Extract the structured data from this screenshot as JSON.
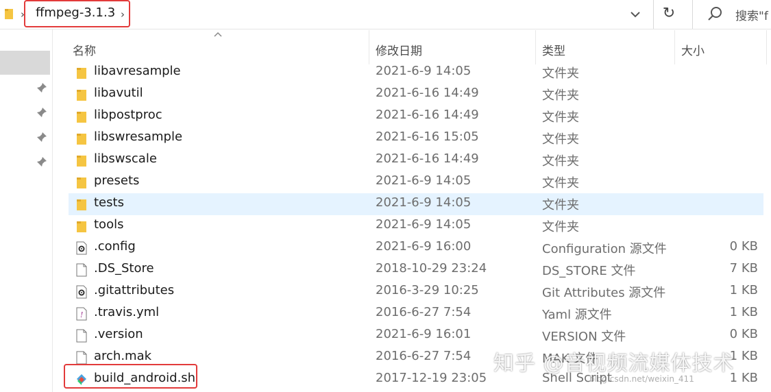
{
  "address_bar": {
    "path": "ffmpeg-3.1.3",
    "search_placeholder": "搜索\"f"
  },
  "columns": {
    "name": "名称",
    "date": "修改日期",
    "type": "类型",
    "size": "大小"
  },
  "files": [
    {
      "name": "libavresample",
      "date": "2021-6-9 14:05",
      "type": "文件夹",
      "size": "",
      "icon": "folder-icon"
    },
    {
      "name": "libavutil",
      "date": "2021-6-16 14:49",
      "type": "文件夹",
      "size": "",
      "icon": "folder-icon"
    },
    {
      "name": "libpostproc",
      "date": "2021-6-16 14:49",
      "type": "文件夹",
      "size": "",
      "icon": "folder-icon"
    },
    {
      "name": "libswresample",
      "date": "2021-6-16 15:05",
      "type": "文件夹",
      "size": "",
      "icon": "folder-icon"
    },
    {
      "name": "libswscale",
      "date": "2021-6-16 14:49",
      "type": "文件夹",
      "size": "",
      "icon": "folder-icon"
    },
    {
      "name": "presets",
      "date": "2021-6-9 14:05",
      "type": "文件夹",
      "size": "",
      "icon": "folder-icon"
    },
    {
      "name": "tests",
      "date": "2021-6-9 14:05",
      "type": "文件夹",
      "size": "",
      "icon": "folder-icon",
      "selected": true
    },
    {
      "name": "tools",
      "date": "2021-6-9 14:05",
      "type": "文件夹",
      "size": "",
      "icon": "folder-icon"
    },
    {
      "name": ".config",
      "date": "2021-6-9 16:00",
      "type": "Configuration 源文件",
      "size": "0 KB",
      "icon": "gear-file-icon"
    },
    {
      "name": ".DS_Store",
      "date": "2018-10-29 23:24",
      "type": "DS_STORE 文件",
      "size": "7 KB",
      "icon": "blank-file-icon"
    },
    {
      "name": ".gitattributes",
      "date": "2016-3-29 10:25",
      "type": "Git Attributes 源文件",
      "size": "1 KB",
      "icon": "gear-file-icon"
    },
    {
      "name": ".travis.yml",
      "date": "2016-6-27 7:54",
      "type": "Yaml 源文件",
      "size": "1 KB",
      "icon": "yaml-file-icon"
    },
    {
      "name": ".version",
      "date": "2021-6-9 16:01",
      "type": "VERSION 文件",
      "size": "0 KB",
      "icon": "blank-file-icon"
    },
    {
      "name": "arch.mak",
      "date": "2016-6-27 7:54",
      "type": "MAK 文件",
      "size": "1 KB",
      "icon": "blank-file-icon"
    },
    {
      "name": "build_android.sh",
      "date": "2017-12-19 23:05",
      "type": "Shell Script",
      "size": "1 KB",
      "icon": "shell-script-icon"
    }
  ],
  "watermark": {
    "text": "知乎 @音视频流媒体技术",
    "url_text": "blog.csdn.net/weixin_411"
  },
  "colors": {
    "highlight_box": "#e23a3a",
    "selected_row": "#e5f3ff",
    "folder": "#f5c542"
  }
}
